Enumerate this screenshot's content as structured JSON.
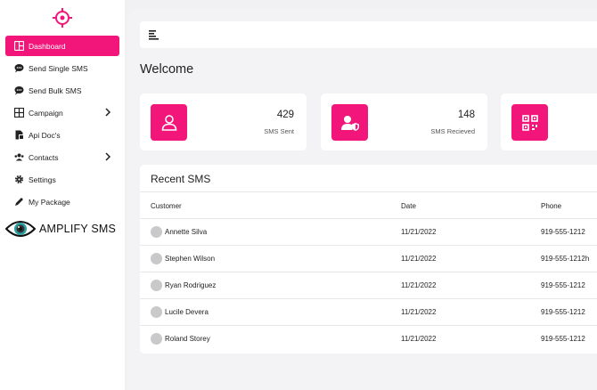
{
  "sidebar": {
    "items": [
      {
        "label": "Dashboard",
        "icon": "dashboard-icon",
        "active": true
      },
      {
        "label": "Send Single SMS",
        "icon": "chat-icon"
      },
      {
        "label": "Send Bulk SMS",
        "icon": "chat-icon"
      },
      {
        "label": "Campaign",
        "icon": "grid-icon",
        "chevron": true
      },
      {
        "label": "Api Doc's",
        "icon": "document-icon"
      },
      {
        "label": "Contacts",
        "icon": "contacts-icon",
        "chevron": true
      },
      {
        "label": "Settings",
        "icon": "gear-icon"
      },
      {
        "label": "My Package",
        "icon": "pen-icon"
      }
    ],
    "brand": "AMPLIFY SMS"
  },
  "main": {
    "welcome": "Welcome",
    "cards": [
      {
        "value": "429",
        "label": "SMS Sent",
        "icon": "user-icon"
      },
      {
        "value": "148",
        "label": "SMS Recieved",
        "icon": "user-shield-icon"
      },
      {
        "value": "",
        "label": "",
        "icon": "qr-code-icon"
      }
    ],
    "recent": {
      "title": "Recent SMS",
      "columns": [
        "Customer",
        "Date",
        "Phone"
      ],
      "rows": [
        {
          "customer": "Annette Silva",
          "date": "11/21/2022",
          "phone": "919-555-1212"
        },
        {
          "customer": "Stephen Wilson",
          "date": "11/21/2022",
          "phone": "919-555-1212h"
        },
        {
          "customer": "Ryan Rodriguez",
          "date": "11/21/2022",
          "phone": "919-555-1212"
        },
        {
          "customer": "Lucile Devera",
          "date": "11/21/2022",
          "phone": "919-555-1212"
        },
        {
          "customer": "Roland Storey",
          "date": "11/21/2022",
          "phone": "919-555-1212"
        }
      ]
    }
  },
  "colors": {
    "accent": "#f2167b"
  }
}
